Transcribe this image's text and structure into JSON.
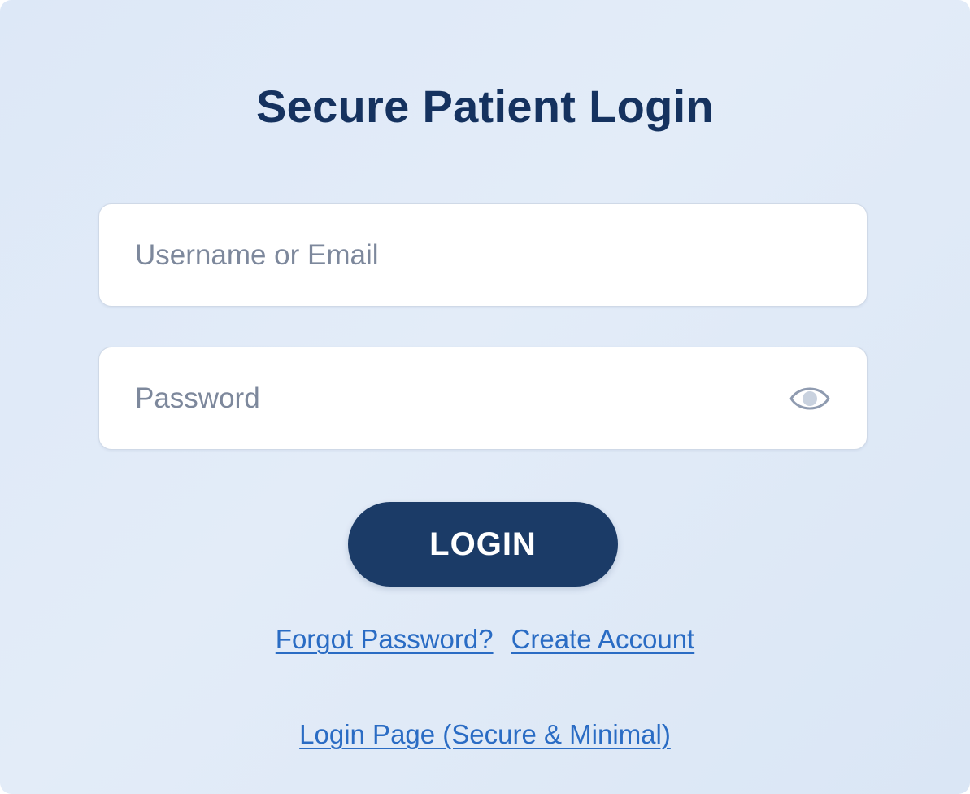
{
  "title": "Secure Patient Login",
  "username_field": {
    "placeholder": "Username or Email",
    "value": ""
  },
  "password_field": {
    "placeholder": "Password",
    "value": "",
    "toggle_icon": "eye-icon"
  },
  "login_button": {
    "label": "LOGIN"
  },
  "links": {
    "forgot_password": "Forgot Password?",
    "create_account": "Create Account"
  },
  "footer": {
    "page_link": "Login Page (Secure & Minimal)"
  },
  "colors": {
    "background": "#dde8f7",
    "title": "#15325f",
    "button": "#1b3b67",
    "link": "#2a6cc4",
    "placeholder": "#7d889c"
  }
}
